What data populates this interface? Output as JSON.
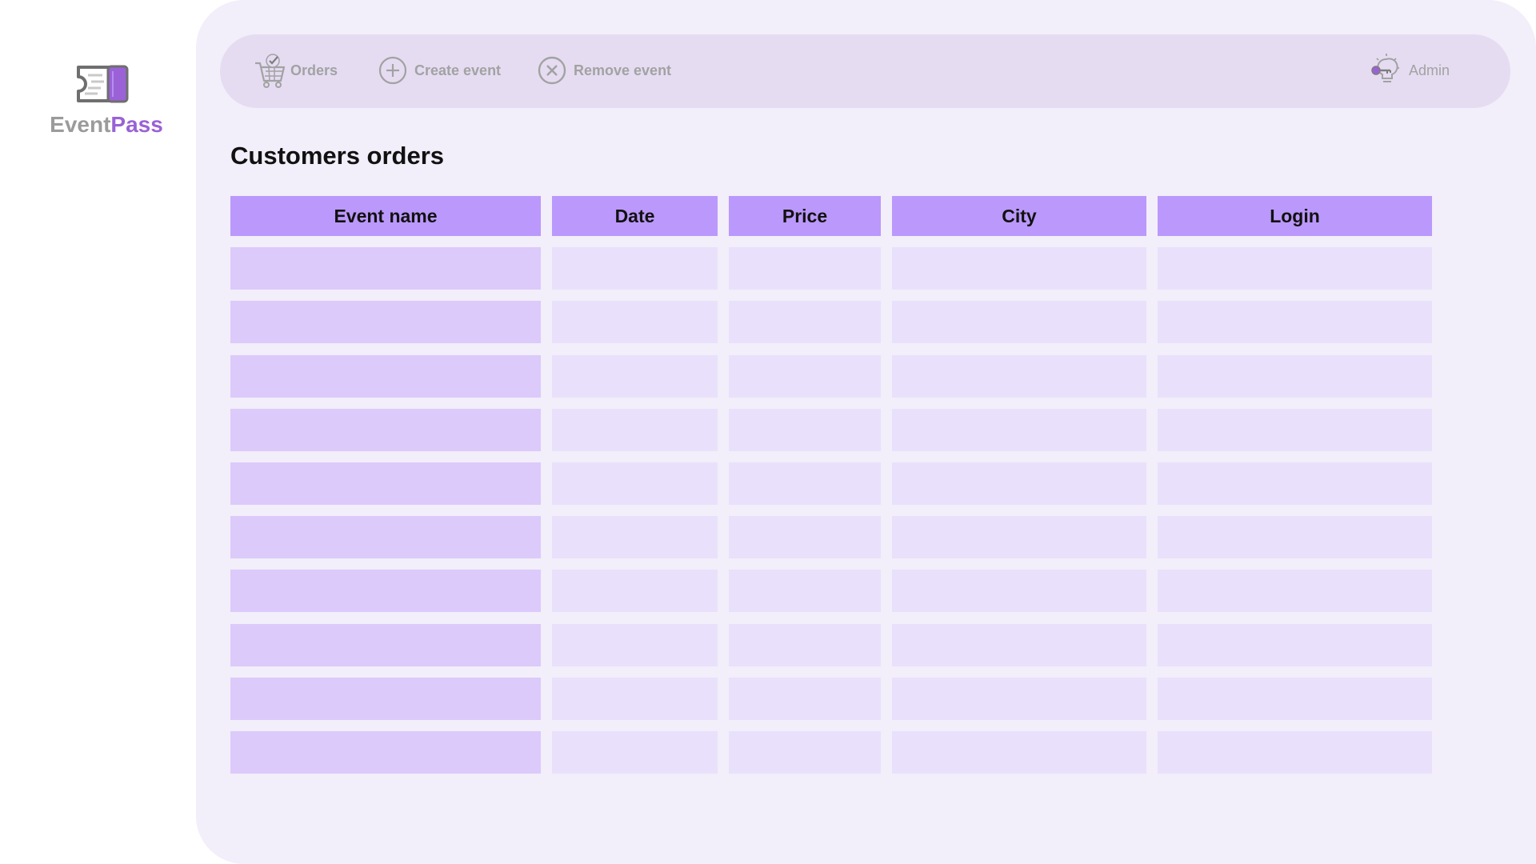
{
  "app": {
    "brand_part1": "Event",
    "brand_part2": "Pass"
  },
  "nav": {
    "orders": "Orders",
    "create_event": "Create event",
    "remove_event": "Remove event",
    "admin": "Admin"
  },
  "page": {
    "title": "Customers orders"
  },
  "table": {
    "columns": [
      "Event name",
      "Date",
      "Price",
      "City",
      "Login"
    ],
    "rows": [
      [
        "",
        "",
        "",
        "",
        ""
      ],
      [
        "",
        "",
        "",
        "",
        ""
      ],
      [
        "",
        "",
        "",
        "",
        ""
      ],
      [
        "",
        "",
        "",
        "",
        ""
      ],
      [
        "",
        "",
        "",
        "",
        ""
      ],
      [
        "",
        "",
        "",
        "",
        ""
      ],
      [
        "",
        "",
        "",
        "",
        ""
      ],
      [
        "",
        "",
        "",
        "",
        ""
      ],
      [
        "",
        "",
        "",
        "",
        ""
      ],
      [
        "",
        "",
        "",
        "",
        ""
      ]
    ]
  },
  "colors": {
    "accent": "#9a62d6",
    "header_cell": "#bb98fb",
    "nav_bar": "#e5dcf2",
    "panel": "#f2eefa"
  },
  "icons": {
    "logo": "ticket-icon",
    "orders": "cart-icon",
    "create": "plus-circle-icon",
    "remove": "x-circle-icon",
    "admin": "lightbulb-key-icon"
  }
}
